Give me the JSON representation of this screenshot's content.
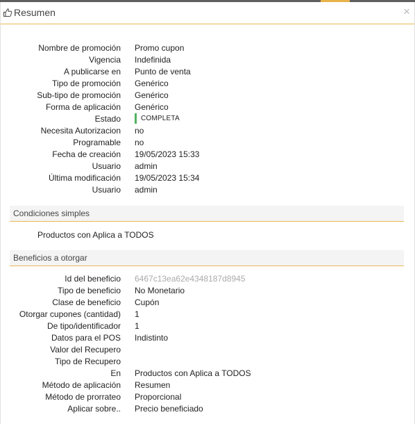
{
  "window": {
    "title": "Resumen",
    "close_glyph": "×",
    "accent_color": "#e6b955",
    "status_color": "#4fb25d"
  },
  "summary": [
    {
      "label": "Nombre de promoción",
      "value": "Promo cupon"
    },
    {
      "label": "Vigencia",
      "value": "Indefinida"
    },
    {
      "label": "A publicarse en",
      "value": "Punto de venta"
    },
    {
      "label": "Tipo de promoción",
      "value": "Genérico"
    },
    {
      "label": "Sub-tipo de promoción",
      "value": "Genérico"
    },
    {
      "label": "Forma de aplicación",
      "value": "Genérico"
    },
    {
      "label": "Estado",
      "value": "COMPLETA",
      "badge": true
    },
    {
      "label": "Necesita Autorizacion",
      "value": "no"
    },
    {
      "label": "Programable",
      "value": "no"
    },
    {
      "label": "Fecha de creación",
      "value": "19/05/2023 15:33"
    },
    {
      "label": "Usuario",
      "value": "admin"
    },
    {
      "label": "Última modificación",
      "value": "19/05/2023 15:34"
    },
    {
      "label": "Usuario",
      "value": "admin"
    }
  ],
  "conditions": {
    "title": "Condiciones simples",
    "items": [
      "Productos con Aplica a TODOS"
    ]
  },
  "benefits": {
    "title": "Beneficios a otorgar",
    "rows": [
      {
        "label": "Id del beneficio",
        "value": "6467c13ea62e4348187d8945",
        "muted": true
      },
      {
        "label": "Tipo de beneficio",
        "value": "No Monetario"
      },
      {
        "label": "Clase de beneficio",
        "value": "Cupón"
      },
      {
        "label": "Otorgar cupones (cantidad)",
        "value": "1"
      },
      {
        "label": "De tipo/identificador",
        "value": "1"
      },
      {
        "label": "Datos para el POS",
        "value": "Indistinto"
      },
      {
        "label": "Valor del Recupero",
        "value": ""
      },
      {
        "label": "Tipo de Recupero",
        "value": ""
      },
      {
        "label": "En",
        "value": "Productos con Aplica a TODOS"
      },
      {
        "label": "Método de aplicación",
        "value": "Resumen"
      },
      {
        "label": "Método de prorrateo",
        "value": "Proporcional"
      },
      {
        "label": "Aplicar sobre..",
        "value": "Precio beneficiado"
      }
    ]
  }
}
